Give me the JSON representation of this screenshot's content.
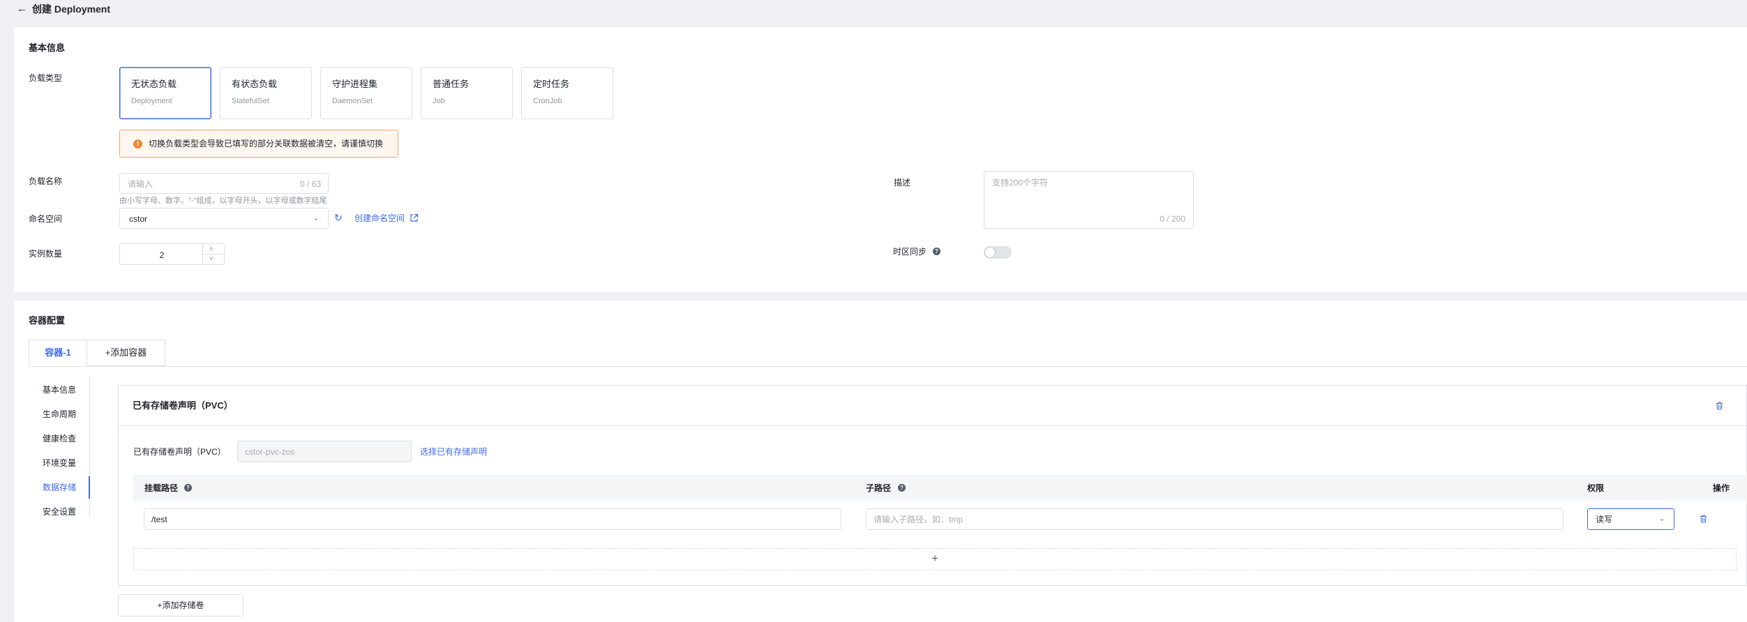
{
  "header": {
    "back_icon": "arrow-left-icon",
    "title": "创建 Deployment"
  },
  "basic": {
    "section_title": "基本信息",
    "workload_label": "负载类型",
    "workload_types": [
      {
        "title": "无状态负载",
        "subtitle": "Deployment",
        "active": true
      },
      {
        "title": "有状态负载",
        "subtitle": "StatefulSet",
        "active": false
      },
      {
        "title": "守护进程集",
        "subtitle": "DaemonSet",
        "active": false
      },
      {
        "title": "普通任务",
        "subtitle": "Job",
        "active": false
      },
      {
        "title": "定时任务",
        "subtitle": "CronJob",
        "active": false
      }
    ],
    "warning": "切换负载类型会导致已填写的部分关联数据被清空，请谨慎切换",
    "name_label": "负载名称",
    "name_placeholder": "请输入",
    "name_counter": "0 / 63",
    "name_hint": "由小写字母、数字、\"-\"组成，以字母开头，以字母或数字结尾",
    "namespace_label": "命名空间",
    "namespace_value": "cstor",
    "create_namespace_link": "创建命名空间",
    "replicas_label": "实例数量",
    "replicas_value": "2",
    "desc_label": "描述",
    "desc_placeholder": "支持200个字符",
    "desc_counter": "0 / 200",
    "timezone_label": "时区同步",
    "timezone_enabled": false
  },
  "container": {
    "section_title": "容器配置",
    "tabs": [
      {
        "label": "容器-1"
      },
      {
        "label": "+添加容器"
      }
    ],
    "side_nav": [
      {
        "label": "基本信息"
      },
      {
        "label": "生命周期"
      },
      {
        "label": "健康检查"
      },
      {
        "label": "环境变量"
      },
      {
        "label": "数据存储"
      },
      {
        "label": "安全设置"
      }
    ],
    "active_side": "数据存储",
    "volume": {
      "title": "已有存储卷声明（PVC）",
      "pvc_label": "已有存储卷声明（PVC）",
      "pvc_value": "cstor-pvc-zos",
      "select_link": "选择已有存储声明",
      "columns": {
        "mount_path": "挂载路径",
        "sub_path": "子路径",
        "permission": "权限",
        "action": "操作"
      },
      "rows": [
        {
          "mount_path": "/test",
          "sub_path_placeholder": "请输入子路径，如：tmp",
          "permission": "读写"
        }
      ],
      "add_row": "+"
    },
    "add_volume_button": "+添加存储卷"
  },
  "colors": {
    "accent": "#3f6ae8",
    "warning": "#f08a34",
    "page_bg": "#eff0f3"
  }
}
